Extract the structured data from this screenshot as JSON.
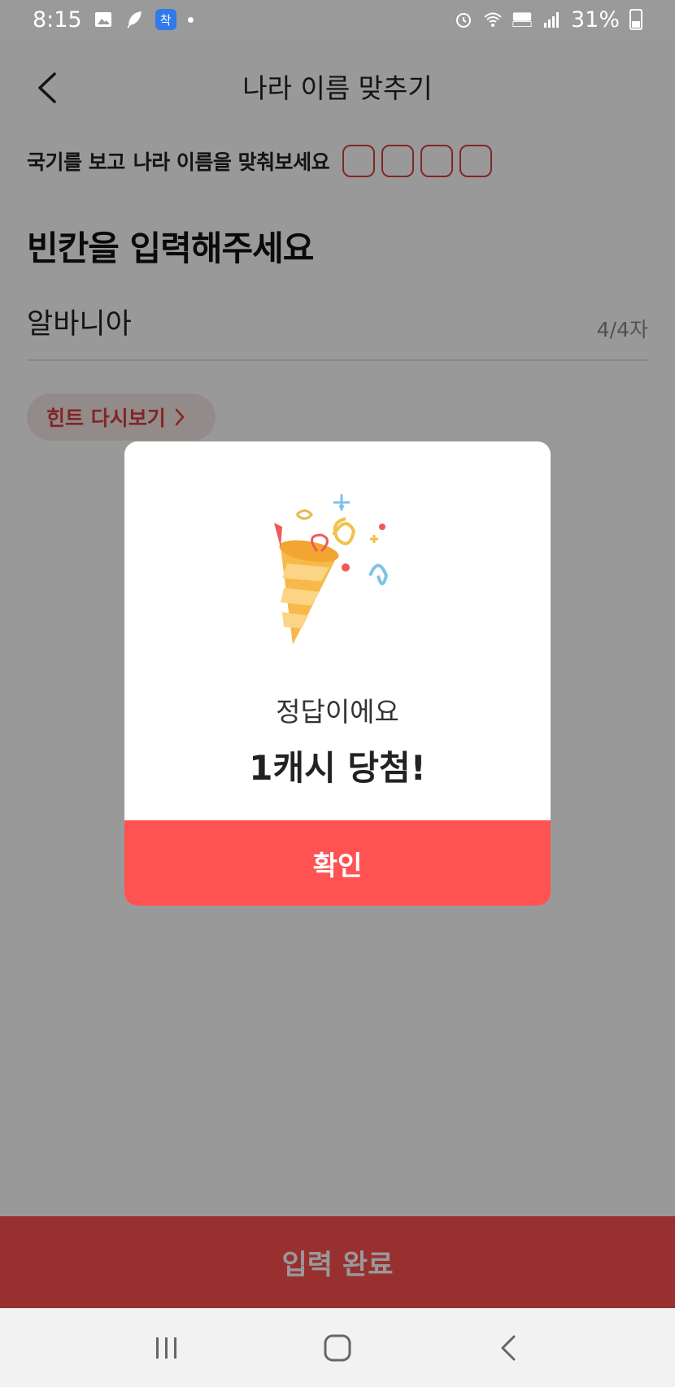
{
  "status_bar": {
    "time": "8:15",
    "app_badge": "착",
    "battery": "31%",
    "icons": [
      "gallery-icon",
      "feather-icon",
      "app-badge-icon",
      "alarm-icon",
      "wifi-icon",
      "hd-voice-icon",
      "signal-icon",
      "battery-icon"
    ]
  },
  "header": {
    "title": "나라 이름 맞추기",
    "back_icon": "chevron-left-icon"
  },
  "quiz": {
    "instruction_1": "국기를 보고",
    "instruction_2": "나라 이름을 맞춰보세요",
    "blank_count": 4,
    "prompt": "빈칸을 입력해주세요",
    "answer": "알바니아",
    "char_counter": "4/4자",
    "hint_label": "힌트 다시보기"
  },
  "submit_button": {
    "label": "입력 완료"
  },
  "modal": {
    "illustration": "party-popper-icon",
    "message": "정답이에요",
    "prize": "1캐시 당첨!",
    "confirm_label": "확인"
  },
  "nav_bar": {
    "items": [
      "recent-apps-icon",
      "home-icon",
      "back-icon"
    ]
  },
  "colors": {
    "accent": "#ff5252",
    "hint_bg": "#f6e6e6",
    "dim_overlay": "rgba(0,0,0,0.40)"
  }
}
